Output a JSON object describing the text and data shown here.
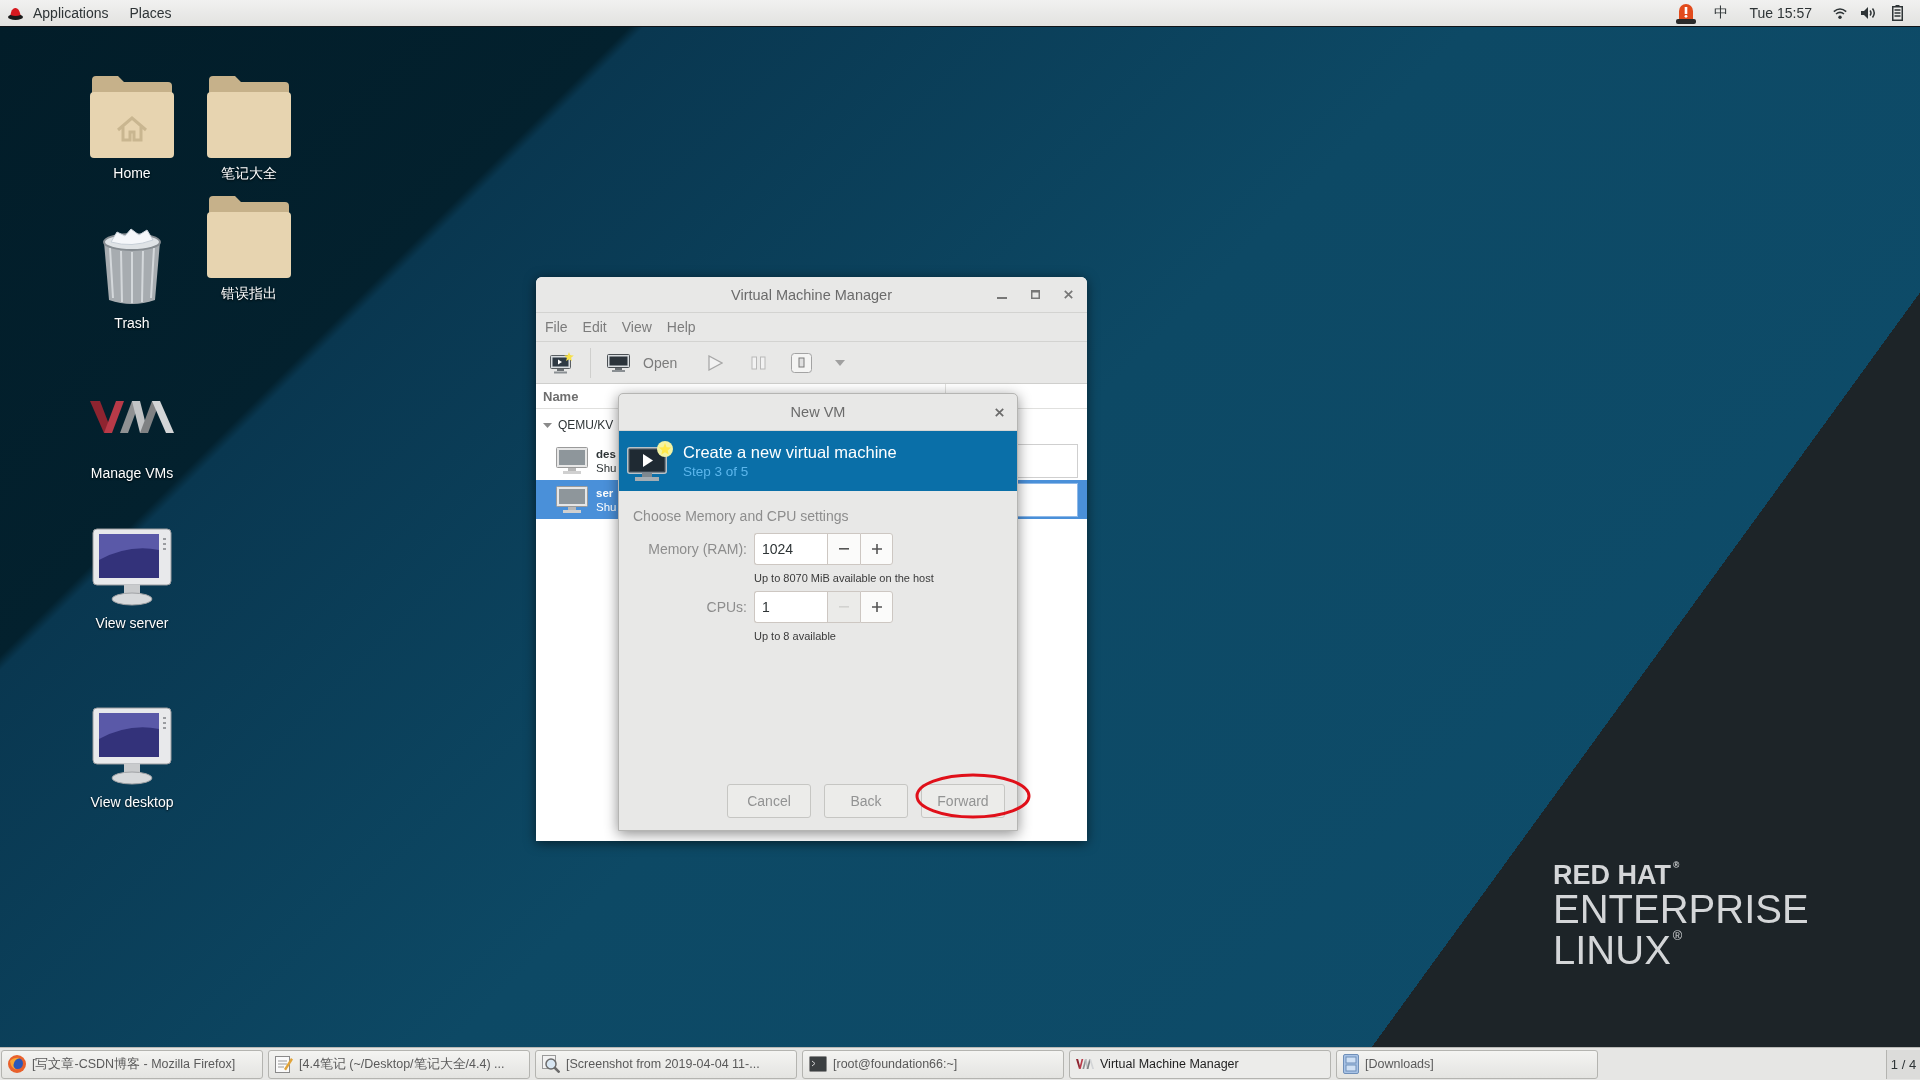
{
  "top_bar": {
    "menus": [
      "Applications",
      "Places"
    ],
    "input_method": "中",
    "clock": "Tue 15:57"
  },
  "desktop_icons": [
    {
      "kind": "home",
      "label": "Home"
    },
    {
      "kind": "trash",
      "label": "Trash"
    },
    {
      "kind": "vm",
      "label": "Manage VMs"
    },
    {
      "kind": "monitor",
      "label": "View server"
    },
    {
      "kind": "monitor",
      "label": "View desktop"
    },
    {
      "kind": "folder",
      "label": "笔记大全"
    },
    {
      "kind": "folder",
      "label": "错误指出"
    }
  ],
  "vm_manager": {
    "title": "Virtual Machine Manager",
    "menu": [
      "File",
      "Edit",
      "View",
      "Help"
    ],
    "toolbar": {
      "open_label": "Open"
    },
    "list": {
      "name_column": "Name",
      "connections": [
        {
          "name": "QEMU/KV",
          "expanded": true,
          "vms": [
            {
              "name": "des",
              "status": "Shu",
              "selected": false
            },
            {
              "name": "ser",
              "status": "Shu",
              "selected": true
            }
          ]
        }
      ]
    }
  },
  "new_vm_dialog": {
    "title": "New VM",
    "header": {
      "title": "Create a new virtual machine",
      "step": "Step 3 of 5"
    },
    "section": "Choose Memory and CPU settings",
    "fields": [
      {
        "label": "Memory (RAM):",
        "value": "1024",
        "hint": "Up to 8070 MiB available on the host",
        "decrement_disabled": false
      },
      {
        "label": "CPUs:",
        "value": "1",
        "hint": "Up to 8 available",
        "decrement_disabled": true
      }
    ],
    "buttons": [
      "Cancel",
      "Back",
      "Forward"
    ]
  },
  "wallpaper_logo": [
    "RED HAT$^{®}$",
    "ENTERPRISE",
    "LINUX$^{®}$"
  ],
  "taskbar": {
    "items": [
      {
        "kind": "browser",
        "label": "[写文章-CSDN博客 - Mozilla Firefox]",
        "selected": false
      },
      {
        "kind": "text-editor",
        "label": "[4.4笔记 (~/Desktop/笔记大全/4.4) ...",
        "selected": false
      },
      {
        "kind": "screenshot",
        "label": "[Screenshot from 2019-04-04 11-...",
        "selected": false
      },
      {
        "kind": "terminal",
        "label": "[root@foundation66:~]",
        "selected": false
      },
      {
        "kind": "vm",
        "label": "Virtual Machine Manager",
        "selected": true
      },
      {
        "kind": "file-cabinet",
        "label": "[Downloads]",
        "selected": false
      }
    ],
    "workspace": "1 / 4"
  }
}
